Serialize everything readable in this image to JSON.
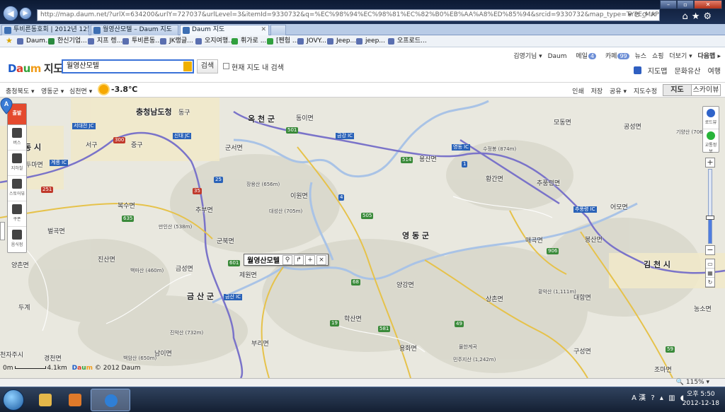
{
  "browser": {
    "url": "http://map.daum.net/?urlX=634200&urlY=727037&urlLevel=3&itemId=9330732&q=%EC%98%94%EC%98%81%EC%82%B0%EB%AA%A8%ED%85%94&srcid=9330732&map_type=TYPE_MAP",
    "tabs": [
      "투비른동호회 | 2012년 12월...",
      "월영산모텔 – Daum 지도",
      "Daum 지도"
    ],
    "favorites": [
      "Daum...",
      "한신기업...",
      "지프 렝...",
      "투비른동...",
      "JK랭글...",
      "오지여행...",
      "휘가로 ...",
      "[펜험 ...",
      "JOVY...",
      "Jeep...",
      "jeep...",
      "오프로드..."
    ]
  },
  "header": {
    "logo_letters": [
      "D",
      "a",
      "u",
      "m"
    ],
    "service_name": "지도",
    "search_value": "월영산모텔",
    "search_button": "검색",
    "inmap_label": "현재 지도 내 검색",
    "user": "김영기님 ▾",
    "gnb": {
      "daum": "Daum",
      "mail": "메일",
      "mail_count": "4",
      "cafe": "카페",
      "cafe_count": "99",
      "news": "뉴스",
      "shopping": "쇼핑",
      "more": "더보기 ▾",
      "next": "다음맵 ▸"
    },
    "services": [
      "지도맵",
      "문화유산",
      "여행"
    ]
  },
  "toolbar": {
    "region1": "충청북도 ▾",
    "region2": "영동군 ▾",
    "region3": "심천면 ▾",
    "temperature": "-3.8℃",
    "tools": [
      "인쇄",
      "저장",
      "공유 ▾",
      "지도수정"
    ],
    "maptype_map": "지도",
    "maptype_sky": "스카이뷰"
  },
  "left_panel": {
    "top": "출발",
    "items": [
      "버스",
      "지하철",
      "스토어뷰",
      "쿠폰",
      "음식점"
    ]
  },
  "right_panel": {
    "items": [
      "로드뷰",
      "교통정보"
    ]
  },
  "zoom": {
    "level_fraction": 0.35
  },
  "map": {
    "labels": [
      {
        "t": "충청남도청",
        "c": "big"
      },
      {
        "t": "옥 천 군",
        "c": "big"
      },
      {
        "t": "영 동 군",
        "c": "big"
      },
      {
        "t": "금 산 군",
        "c": "big"
      },
      {
        "t": "김 천 시",
        "c": "big"
      },
      {
        "t": "동 시",
        "c": "big"
      },
      {
        "t": "서구",
        "c": ""
      },
      {
        "t": "중구",
        "c": ""
      },
      {
        "t": "동구",
        "c": ""
      },
      {
        "t": "동이면",
        "c": ""
      },
      {
        "t": "군서면",
        "c": ""
      },
      {
        "t": "용산면",
        "c": ""
      },
      {
        "t": "모동면",
        "c": ""
      },
      {
        "t": "공성면",
        "c": ""
      },
      {
        "t": "황간면",
        "c": ""
      },
      {
        "t": "추풍령면",
        "c": ""
      },
      {
        "t": "어모면",
        "c": ""
      },
      {
        "t": "이원면",
        "c": ""
      },
      {
        "t": "복수면",
        "c": ""
      },
      {
        "t": "추부면",
        "c": ""
      },
      {
        "t": "벌곡면",
        "c": ""
      },
      {
        "t": "진산면",
        "c": ""
      },
      {
        "t": "군북면",
        "c": ""
      },
      {
        "t": "양촌면",
        "c": ""
      },
      {
        "t": "금성면",
        "c": ""
      },
      {
        "t": "제원면",
        "c": ""
      },
      {
        "t": "양강면",
        "c": ""
      },
      {
        "t": "매곡면",
        "c": ""
      },
      {
        "t": "봉산면",
        "c": ""
      },
      {
        "t": "상촌면",
        "c": ""
      },
      {
        "t": "대항면",
        "c": ""
      },
      {
        "t": "학산면",
        "c": ""
      },
      {
        "t": "용화면",
        "c": ""
      },
      {
        "t": "부리면",
        "c": ""
      },
      {
        "t": "남이면",
        "c": ""
      },
      {
        "t": "경천면",
        "c": ""
      },
      {
        "t": "구성면",
        "c": ""
      },
      {
        "t": "조마면",
        "c": ""
      },
      {
        "t": "농소면",
        "c": ""
      },
      {
        "t": "두마면",
        "c": ""
      },
      {
        "t": "두계",
        "c": ""
      },
      {
        "t": "장용산 (656m)",
        "c": "peak"
      },
      {
        "t": "대성산 (705m)",
        "c": "peak"
      },
      {
        "t": "만인산 (538m)",
        "c": "peak"
      },
      {
        "t": "백마산 (460m)",
        "c": "peak"
      },
      {
        "t": "진악산 (732m)",
        "c": "peak"
      },
      {
        "t": "백암산 (650m)",
        "c": "peak"
      },
      {
        "t": "수정봉 (874m)",
        "c": "peak"
      },
      {
        "t": "황악산 (1,111m)",
        "c": "peak"
      },
      {
        "t": "민주지산 (1,242m)",
        "c": "peak"
      },
      {
        "t": "기양산 (706m)",
        "c": "peak"
      },
      {
        "t": "물한계곡",
        "c": "peak"
      },
      {
        "t": "천자주시",
        "c": ""
      }
    ],
    "shields": [
      "501",
      "514",
      "505",
      "4",
      "19",
      "68",
      "581",
      "49",
      "635",
      "601",
      "906",
      "59",
      "1",
      "25",
      "300",
      "251",
      "35"
    ],
    "interchanges": [
      "서대전 JC",
      "계룡 IC",
      "신대 JC",
      "금강 IC",
      "영동 IC",
      "추풍령 IC",
      "금산 IC"
    ],
    "popup_name": "월영산모텔",
    "marker_letter": "A",
    "scale_start": "0m",
    "scale_end": "4.1km",
    "copyright": "© 2012 Daum"
  },
  "status": {
    "zoom": "115%"
  },
  "taskbar": {
    "tray_input": "A 漢",
    "time": "오후 5:50",
    "date": "2012-12-18"
  }
}
